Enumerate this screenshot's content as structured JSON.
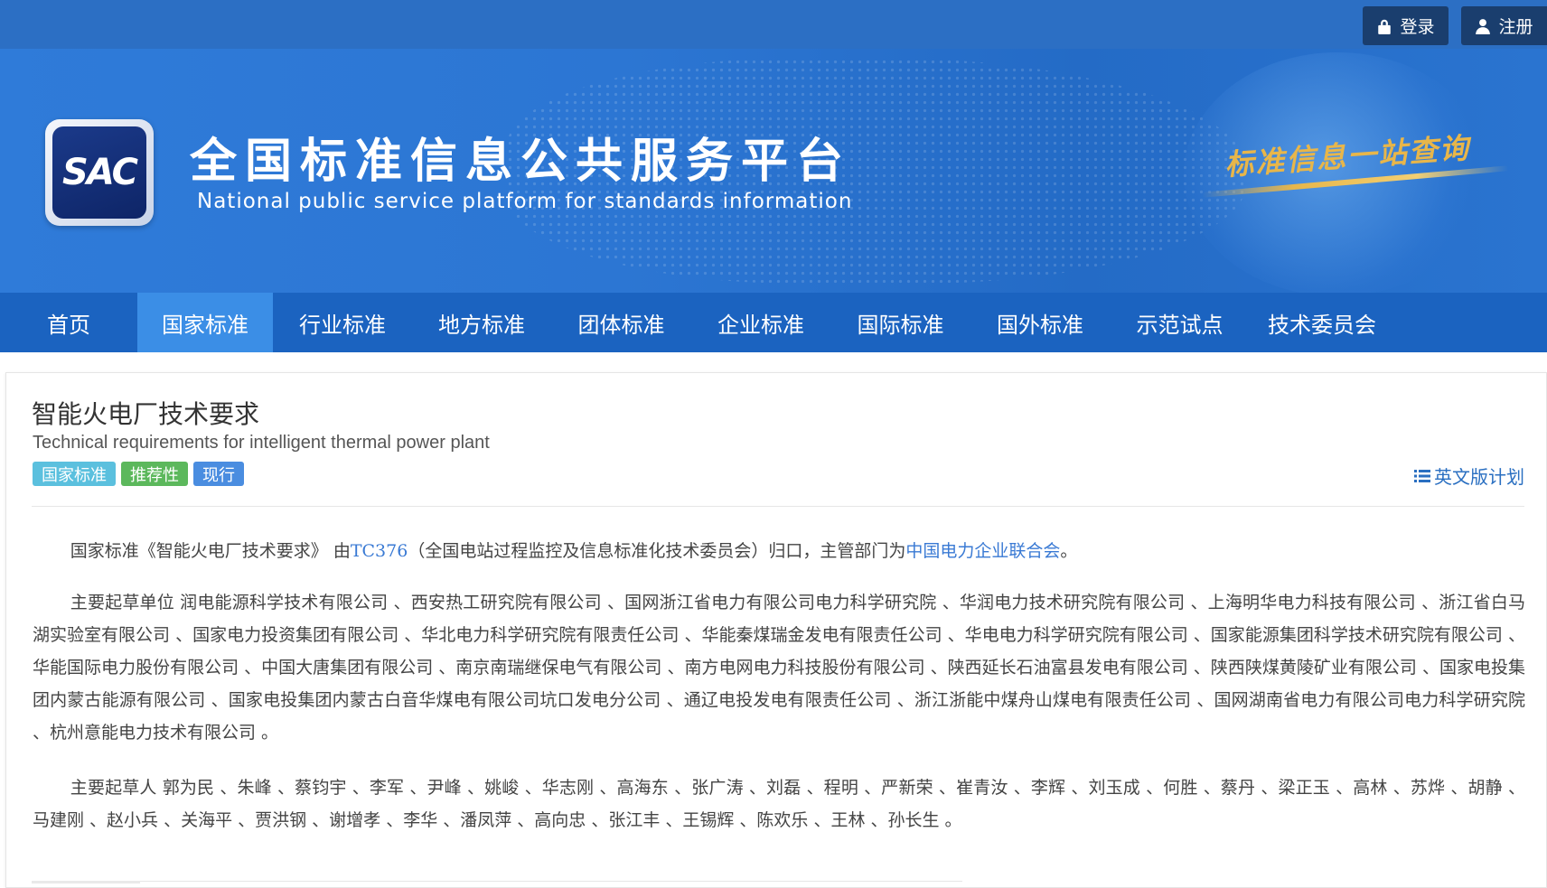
{
  "header": {
    "login_label": "登录",
    "register_label": "注册",
    "logo_text": "SAC",
    "site_title": "全国标准信息公共服务平台",
    "site_subtitle": "National public service platform  for standards information",
    "slogan": "标准信息一站查询"
  },
  "nav": {
    "items": [
      "首页",
      "国家标准",
      "行业标准",
      "地方标准",
      "团体标准",
      "企业标准",
      "国际标准",
      "国外标准",
      "示范试点",
      "技术委员会"
    ],
    "active": "国家标准"
  },
  "standard": {
    "title": "智能火电厂技术要求",
    "title_en": "Technical requirements for intelligent thermal power plant",
    "tags": {
      "level": "国家标准",
      "nature": "推荐性",
      "status": "现行"
    },
    "en_plan_label": "英文版计划",
    "intro": {
      "prefix": "国家标准《智能火电厂技术要求》 由",
      "tc_code": "TC376",
      "tc_name": "（全国电站过程监控及信息标准化技术委员会）归口，主管部门为",
      "authority": "中国电力企业联合会",
      "suffix": "。"
    },
    "drafting_units_label": "主要起草单位",
    "drafting_units": "润电能源科学技术有限公司 、西安热工研究院有限公司 、国网浙江省电力有限公司电力科学研究院 、华润电力技术研究院有限公司 、上海明华电力科技有限公司 、浙江省白马湖实验室有限公司 、国家电力投资集团有限公司 、华北电力科学研究院有限责任公司 、华能秦煤瑞金发电有限责任公司 、华电电力科学研究院有限公司 、国家能源集团科学技术研究院有限公司 、华能国际电力股份有限公司 、中国大唐集团有限公司 、南京南瑞继保电气有限公司 、南方电网电力科技股份有限公司 、陕西延长石油富县发电有限公司 、陕西陕煤黄陵矿业有限公司 、国家电投集团内蒙古能源有限公司 、国家电投集团内蒙古白音华煤电有限公司坑口发电分公司 、通辽电投发电有限责任公司 、浙江浙能中煤舟山煤电有限责任公司 、国网湖南省电力有限公司电力科学研究院 、杭州意能电力技术有限公司 。",
    "drafters_label": "主要起草人",
    "drafters": "郭为民 、朱峰 、蔡钧宇 、李军 、尹峰 、姚峻 、华志刚 、高海东 、张广涛 、刘磊 、程明 、严新荣 、崔青汝 、李辉 、刘玉成 、何胜 、蔡丹 、梁正玉 、高林 、苏烨 、胡静 、马建刚 、赵小兵 、关海平 、贾洪钢 、谢增孝 、李华 、潘凤萍 、高向忠 、张江丰 、王锡辉 、陈欢乐 、王林 、孙长生 。"
  },
  "colors": {
    "topbar": "#2c6fc4",
    "nav": "#1b63c0",
    "nav_active": "#3b8ee6",
    "link": "#3a7ad4",
    "tag_national": "#5bc0de",
    "tag_recommend": "#5cb85c",
    "tag_current": "#4a8de0",
    "slogan": "#e8b64a"
  }
}
